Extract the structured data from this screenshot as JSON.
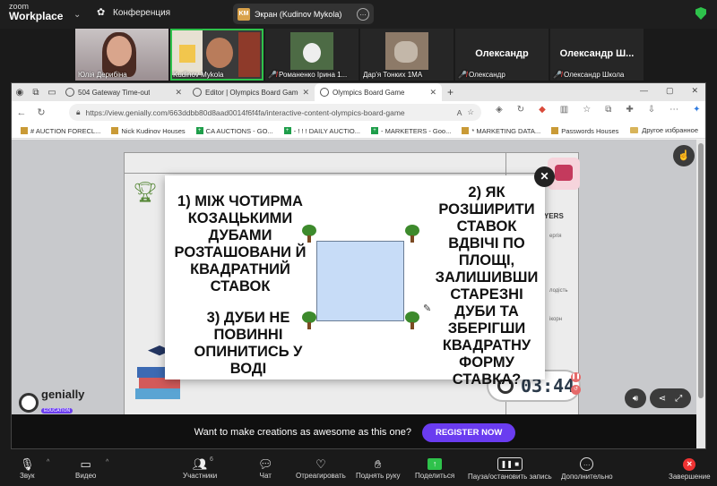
{
  "zoom": {
    "logo_line1": "zoom",
    "logo_line2": "Workplace",
    "chevron": "⌄",
    "meeting_title": "Конференция",
    "screen_badge": "KM",
    "screen_label": "Экран (Kudinov Mykola)",
    "screen_more": "…"
  },
  "participants": [
    {
      "name": "Юлія Дерибіна",
      "muted": false
    },
    {
      "name": "Kudinov Mykola",
      "muted": false
    },
    {
      "name": "Романенко Ірина 1...",
      "muted": true
    },
    {
      "name": "Дар'я Тонких 1МА",
      "muted": false
    },
    {
      "name": "Олександр",
      "big_name": "Олександр",
      "muted": true
    },
    {
      "name": "Олександр Школа",
      "big_name": "Олександр Ш...",
      "muted": true
    }
  ],
  "browser": {
    "tabs": [
      {
        "label": "504 Gateway Time-out",
        "close": "✕"
      },
      {
        "label": "Editor | Olympics Board Game",
        "close": "✕"
      },
      {
        "label": "Olympics Board Game",
        "close": "✕"
      }
    ],
    "new_tab": "+",
    "window_controls": [
      "—",
      "▢",
      "✕"
    ],
    "url": "https://view.genially.com/663ddbb80d8aad0014f6f4fa/interactive-content-olympics-board-game",
    "bookmarks": [
      {
        "label": "# AUCTION FORECL...",
        "icon": "doc"
      },
      {
        "label": "Nick Kudinov Houses",
        "icon": "doc"
      },
      {
        "label": "CA AUCTIONS - GO...",
        "icon": "sheet"
      },
      {
        "label": "- ! ! ! DAILY AUCTIO...",
        "icon": "sheet"
      },
      {
        "label": "- MARKETERS - Goo...",
        "icon": "sheet"
      },
      {
        "label": "* MARKETING DATA...",
        "icon": "doc"
      },
      {
        "label": "Passwords Houses",
        "icon": "doc"
      }
    ],
    "other_bookmarks": "Другое избранное"
  },
  "board": {
    "side_header": "YERS",
    "side_1": "ергія",
    "side_2": "лодість",
    "side_3": "ікорн",
    "timer": "03:44"
  },
  "modal": {
    "q1": "1) МІЖ ЧОТИРМА КОЗАЦЬКИМИ ДУБАМИ РОЗТАШОВАНИ Й КВАДРАТНИЙ СТАВОК",
    "q2": "2) ЯК РОЗШИРИТИ СТАВОК ВДВІЧІ ПО ПЛОЩІ, ЗАЛИШИВШИ СТАРЕЗНІ ДУБИ ТА ЗБЕРІГШИ КВАДРАТНУ ФОРМУ СТАВКА?",
    "q3": "3) ДУБИ НЕ ПОВИННІ ОПИНИТИСЬ У ВОДІ",
    "close": "✕"
  },
  "genially": {
    "brand": "genially",
    "badge": "EDUCATION"
  },
  "banner": {
    "text": "Want to make creations as awesome as this one?",
    "button": "REGISTER NOW"
  },
  "toolbar": {
    "audio": "Звук",
    "video": "Видео",
    "participants": "Участники",
    "participants_count": "6",
    "chat": "Чат",
    "react": "Отреагировать",
    "raise_hand": "Поднять руку",
    "share": "Поделиться",
    "pause": "Пауза/остановить запись",
    "more": "Дополнительно",
    "end": "Завершение"
  }
}
